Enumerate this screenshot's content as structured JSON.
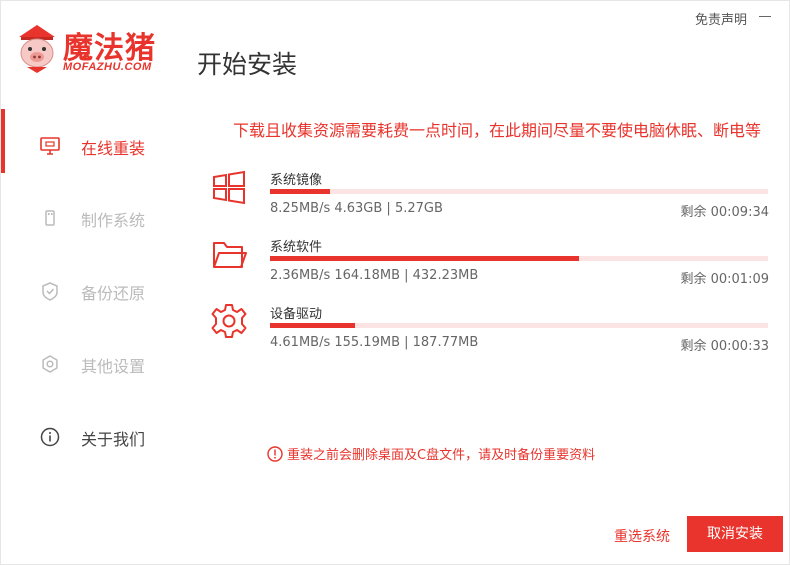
{
  "header": {
    "logo_text": "魔法猪",
    "logo_sub": "MOFAZHU.COM",
    "title": "开始安装",
    "disclaimer": "免责声明"
  },
  "sidebar": {
    "items": [
      {
        "label": "在线重装",
        "icon": "monitor-icon",
        "state": "active"
      },
      {
        "label": "制作系统",
        "icon": "usb-icon",
        "state": "inactive"
      },
      {
        "label": "备份还原",
        "icon": "backup-icon",
        "state": "inactive"
      },
      {
        "label": "其他设置",
        "icon": "settings-icon",
        "state": "inactive"
      },
      {
        "label": "关于我们",
        "icon": "info-icon",
        "state": "normal"
      }
    ]
  },
  "main": {
    "notice": "下载且收集资源需要耗费一点时间，在此期间尽量不要使电脑休眠、断电等",
    "downloads": [
      {
        "name": "系统镜像",
        "icon": "windows-icon",
        "speed": "8.25MB/s 4.63GB | 5.27GB",
        "remaining": "剩余 00:09:34",
        "progress": 0.12
      },
      {
        "name": "系统软件",
        "icon": "folder-icon",
        "speed": "2.36MB/s 164.18MB | 432.23MB",
        "remaining": "剩余 00:01:09",
        "progress": 0.62
      },
      {
        "name": "设备驱动",
        "icon": "gear-icon",
        "speed": "4.61MB/s 155.19MB | 187.77MB",
        "remaining": "剩余 00:00:33",
        "progress": 0.17
      }
    ],
    "warning": "重装之前会删除桌面及C盘文件，请及时备份重要资料"
  },
  "footer": {
    "reselect_label": "重选系统",
    "cancel_label": "取消安装"
  },
  "colors": {
    "accent": "#e8342c",
    "track": "#fbe4e3",
    "inactive_text": "#bbbbbb"
  }
}
